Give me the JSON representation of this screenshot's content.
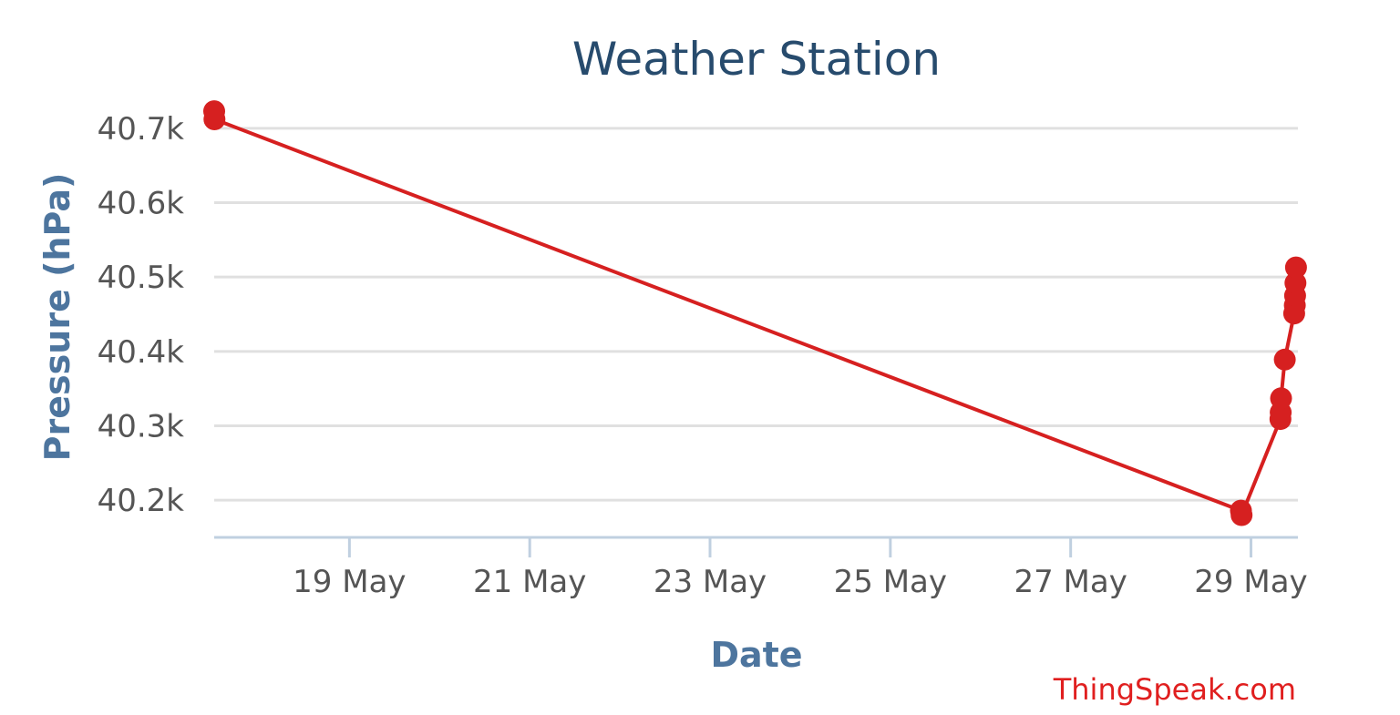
{
  "chart_data": {
    "type": "line",
    "title": "Weather Station",
    "xlabel": "Date",
    "ylabel": "Pressure (hPa)",
    "credit": "ThingSpeak.com",
    "y_ticks": [
      40200,
      40300,
      40400,
      40500,
      40600,
      40700
    ],
    "y_tick_labels": [
      "40.2k",
      "40.3k",
      "40.4k",
      "40.5k",
      "40.6k",
      "40.7k"
    ],
    "x_ticks": [
      "19 May",
      "21 May",
      "23 May",
      "25 May",
      "27 May",
      "29 May"
    ],
    "x_tick_dates": [
      "2018-05-19",
      "2018-05-21",
      "2018-05-23",
      "2018-05-25",
      "2018-05-27",
      "2018-05-29"
    ],
    "xlim": [
      "2018-05-17 12:00",
      "2018-05-29 12:30"
    ],
    "ylim": [
      40150,
      40750
    ],
    "grid": true,
    "series_color": "#d62020",
    "series": [
      {
        "name": "",
        "points": [
          {
            "x": "2018-05-17 12:00",
            "y": 40723
          },
          {
            "x": "2018-05-17 12:05",
            "y": 40712
          },
          {
            "x": "2018-05-28 21:20",
            "y": 40186
          },
          {
            "x": "2018-05-28 21:30",
            "y": 40180
          },
          {
            "x": "2018-05-29 07:50",
            "y": 40309
          },
          {
            "x": "2018-05-29 07:55",
            "y": 40318
          },
          {
            "x": "2018-05-29 08:00",
            "y": 40337
          },
          {
            "x": "2018-05-29 09:00",
            "y": 40389
          },
          {
            "x": "2018-05-29 11:30",
            "y": 40451
          },
          {
            "x": "2018-05-29 11:40",
            "y": 40462
          },
          {
            "x": "2018-05-29 11:45",
            "y": 40475
          },
          {
            "x": "2018-05-29 11:50",
            "y": 40492
          },
          {
            "x": "2018-05-29 12:00",
            "y": 40513
          }
        ]
      }
    ]
  }
}
